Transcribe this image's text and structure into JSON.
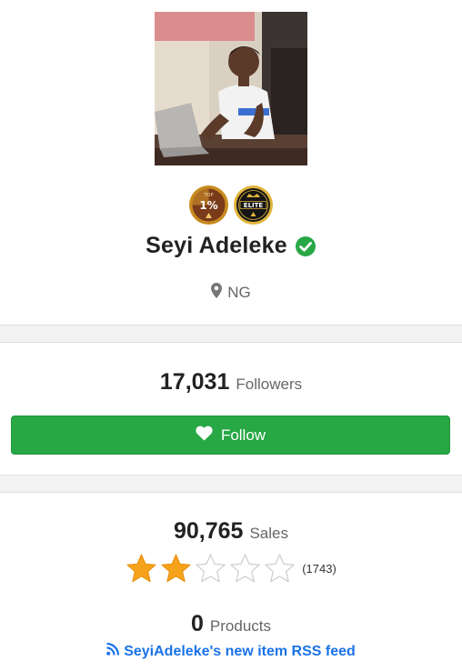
{
  "profile": {
    "name": "Seyi Adeleke",
    "location": "NG",
    "badges": [
      {
        "icon": "top-1-percent-badge-icon",
        "text": "1%",
        "small": "TOP"
      },
      {
        "icon": "elite-badge-icon",
        "text": "ELITE"
      }
    ],
    "verified": true
  },
  "followers": {
    "count": "17,031",
    "label": "Followers"
  },
  "follow_button": {
    "label": "Follow"
  },
  "sales": {
    "count": "90,765",
    "label": "Sales"
  },
  "rating": {
    "stars": 2,
    "max": 5,
    "count_text": "(1743)"
  },
  "products": {
    "count": "0",
    "label": "Products"
  },
  "rss": {
    "label": "SeyiAdeleke's new item RSS feed"
  },
  "colors": {
    "accent_green": "#28a745",
    "link_blue": "#1a73e8",
    "star_gold": "#f7a21b"
  }
}
